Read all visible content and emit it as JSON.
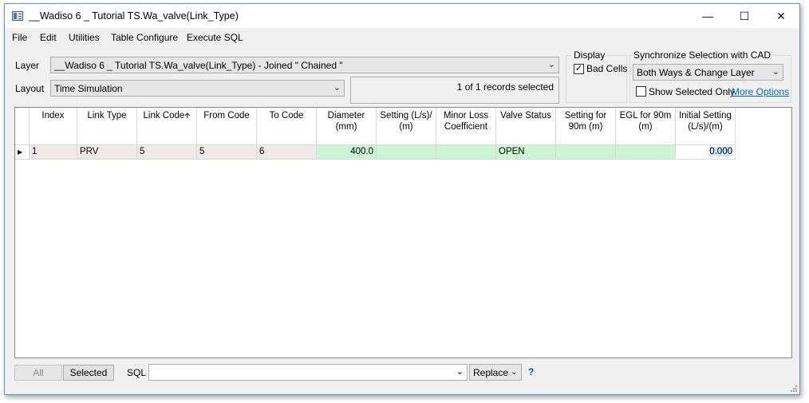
{
  "window": {
    "title": "__Wadiso 6 _ Tutorial TS.Wa_valve(Link_Type)",
    "minimize": "—",
    "maximize": "☐",
    "close": "✕"
  },
  "menu": [
    "File",
    "Edit",
    "Utilities",
    "Table Configure",
    "Execute SQL"
  ],
  "layer": {
    "label": "Layer",
    "value": "__Wadiso 6 _ Tutorial TS.Wa_valve(Link_Type) - Joined \" Chained \""
  },
  "layout": {
    "label": "Layout",
    "value": "Time Simulation"
  },
  "records_status": "1 of 1 records selected",
  "display": {
    "title": "Display",
    "bad_cells_label": "Bad Cells",
    "bad_cells_checked": true
  },
  "sync": {
    "title": "Synchronize Selection with CAD",
    "value": "Both Ways & Change Layer",
    "show_selected_only_label": "Show Selected Only",
    "show_selected_only_checked": false,
    "more_options": "More Options"
  },
  "table": {
    "columns": [
      "Index",
      "Link Type",
      "Link Code",
      "From Code",
      "To Code",
      "Diameter\n(mm)",
      "Setting (L/s)/\n(m)",
      "Minor Loss\nCoefficient",
      "Valve Status",
      "Setting for\n90m (m)",
      "EGL for 90m\n(m)",
      "Initial Setting\n(L/s)/(m)"
    ],
    "sort_column": "Link Code",
    "rows": [
      {
        "cells": [
          "1",
          "PRV",
          "5",
          "5",
          "6",
          "400.0",
          "",
          "",
          "OPEN",
          "",
          "",
          "0.000"
        ]
      }
    ]
  },
  "colors": {
    "editable_cell": "#ccf5d3",
    "readonly_cell": "#f0e9e9",
    "selected_cell": "#cce8ff",
    "link": "#0066cc"
  },
  "bottom": {
    "all_button": "All",
    "selected_button": "Selected",
    "sql_label": "SQL",
    "sql_value": "",
    "replace_value": "Replace",
    "help": "?"
  }
}
